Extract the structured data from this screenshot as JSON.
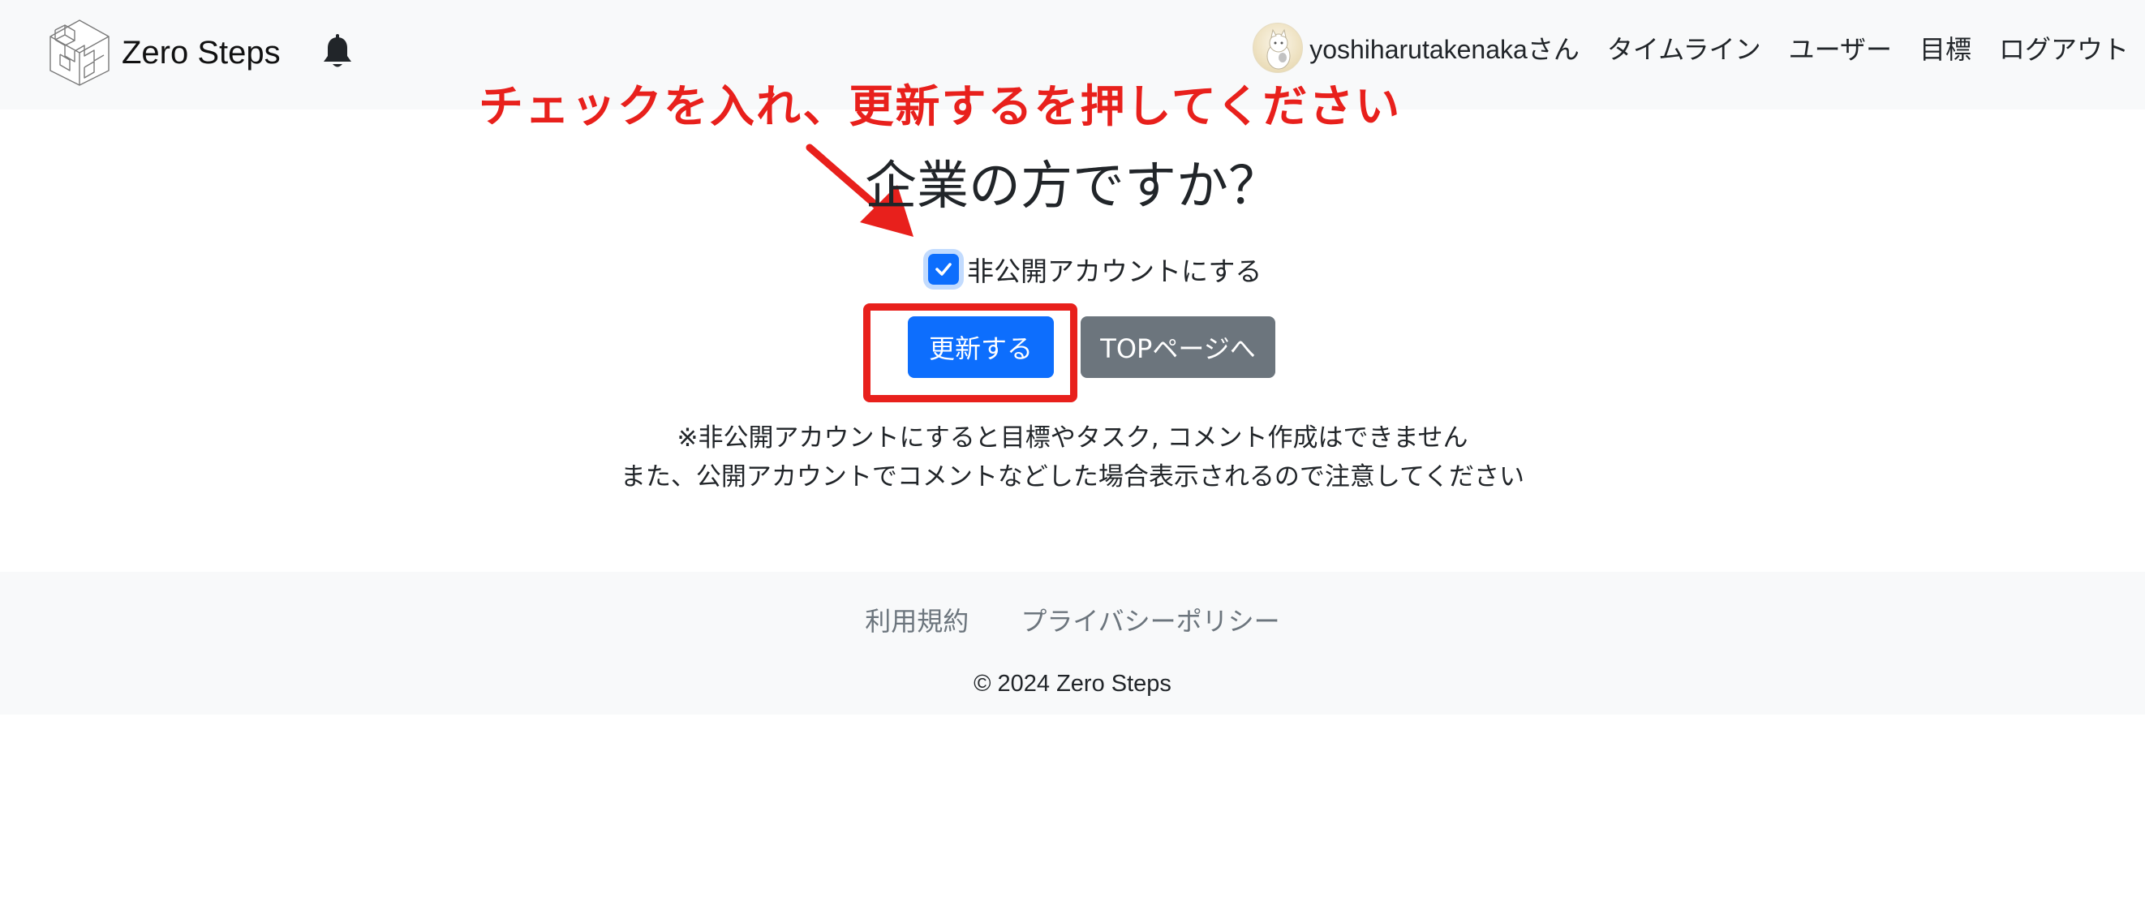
{
  "header": {
    "brand_name": "Zero Steps",
    "username": "yoshiharutakenakaさん",
    "nav": [
      {
        "label": "タイムライン"
      },
      {
        "label": "ユーザー"
      },
      {
        "label": "目標"
      },
      {
        "label": "ログアウト"
      }
    ]
  },
  "annotation": {
    "text": "チェックを入れ、更新するを押してください",
    "color": "#e8201c"
  },
  "main": {
    "title": "企業の方ですか？",
    "checkbox_label": "非公開アカウントにする",
    "checkbox_checked": true,
    "update_button": "更新する",
    "top_button": "TOPページへ",
    "notes": [
      "※非公開アカウントにすると目標やタスク, コメント作成はできません",
      "また、公開アカウントでコメントなどした場合表示されるので注意してください"
    ]
  },
  "footer": {
    "links": [
      {
        "label": "利用規約"
      },
      {
        "label": "プライバシーポリシー"
      }
    ],
    "copyright": "© 2024 Zero Steps"
  },
  "colors": {
    "primary": "#0d6efd",
    "secondary": "#6c757d",
    "navbar_bg": "#f8f9fa",
    "annotation_red": "#e8201c"
  },
  "icons": {
    "brand": "isometric-cube-stairs-icon",
    "notifications": "bell-icon",
    "checkbox": "check-icon",
    "arrow": "red-arrow-icon"
  }
}
